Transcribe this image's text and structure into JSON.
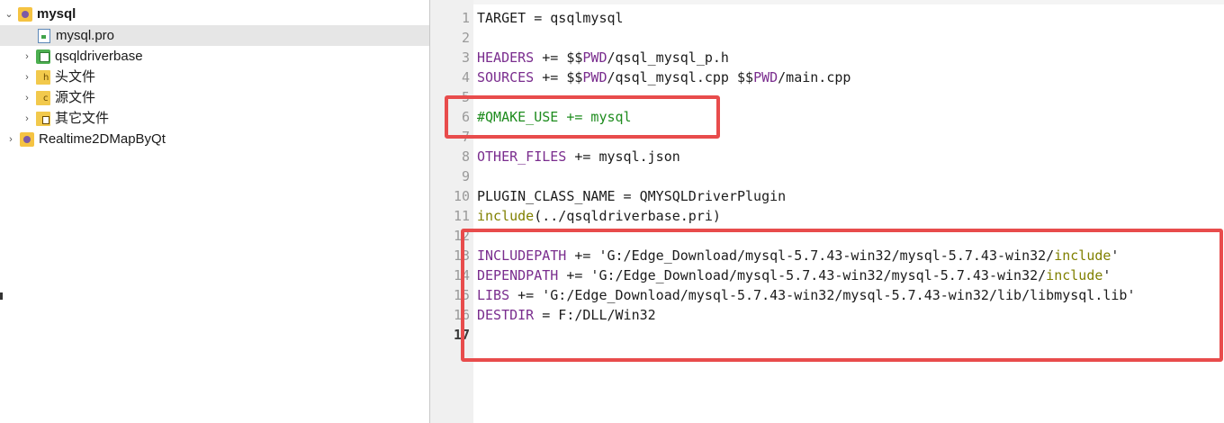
{
  "tree": {
    "items": [
      {
        "label": "mysql",
        "arrow": "⌄",
        "icon": "qt-project-icon",
        "bold": true
      },
      {
        "label": "mysql.pro",
        "arrow": "",
        "icon": "pro-file-icon",
        "selected": true
      },
      {
        "label": "qsqldriverbase",
        "arrow": "›",
        "icon": "pri-project-icon"
      },
      {
        "label": "头文件",
        "arrow": "›",
        "icon": "header-folder-icon"
      },
      {
        "label": "源文件",
        "arrow": "›",
        "icon": "source-folder-icon"
      },
      {
        "label": "其它文件",
        "arrow": "›",
        "icon": "other-files-folder-icon"
      },
      {
        "label": "Realtime2DMapByQt",
        "arrow": "›",
        "icon": "qt-project-icon"
      }
    ]
  },
  "editor": {
    "lines": [
      {
        "n": "1",
        "tokens": [
          [
            "plain",
            "TARGET = qsqlmysql"
          ]
        ]
      },
      {
        "n": "2",
        "tokens": []
      },
      {
        "n": "3",
        "tokens": [
          [
            "var",
            "HEADERS"
          ],
          [
            "plain",
            " += $$"
          ],
          [
            "var",
            "PWD"
          ],
          [
            "plain",
            "/qsql_mysql_p.h"
          ]
        ]
      },
      {
        "n": "4",
        "tokens": [
          [
            "var",
            "SOURCES"
          ],
          [
            "plain",
            " += $$"
          ],
          [
            "var",
            "PWD"
          ],
          [
            "plain",
            "/qsql_mysql.cpp $$"
          ],
          [
            "var",
            "PWD"
          ],
          [
            "plain",
            "/main.cpp"
          ]
        ]
      },
      {
        "n": "5",
        "tokens": []
      },
      {
        "n": "6",
        "tokens": [
          [
            "comment",
            "#QMAKE_USE += mysql"
          ]
        ]
      },
      {
        "n": "7",
        "tokens": []
      },
      {
        "n": "8",
        "tokens": [
          [
            "var",
            "OTHER_FILES"
          ],
          [
            "plain",
            " += mysql.json"
          ]
        ]
      },
      {
        "n": "9",
        "tokens": []
      },
      {
        "n": "10",
        "tokens": [
          [
            "plain",
            "PLUGIN_CLASS_NAME = QMYSQLDriverPlugin"
          ]
        ]
      },
      {
        "n": "11",
        "tokens": [
          [
            "kw",
            "include"
          ],
          [
            "plain",
            "(../qsqldriverbase.pri)"
          ]
        ]
      },
      {
        "n": "12",
        "tokens": []
      },
      {
        "n": "13",
        "tokens": [
          [
            "var",
            "INCLUDEPATH"
          ],
          [
            "plain",
            " += 'G:/Edge_Download/mysql-5.7.43-win32/mysql-5.7.43-win32/"
          ],
          [
            "kw",
            "include"
          ],
          [
            "plain",
            "'"
          ]
        ]
      },
      {
        "n": "14",
        "tokens": [
          [
            "var",
            "DEPENDPATH"
          ],
          [
            "plain",
            " += 'G:/Edge_Download/mysql-5.7.43-win32/mysql-5.7.43-win32/"
          ],
          [
            "kw",
            "include"
          ],
          [
            "plain",
            "'"
          ]
        ]
      },
      {
        "n": "15",
        "tokens": [
          [
            "var",
            "LIBS"
          ],
          [
            "plain",
            " += 'G:/Edge_Download/mysql-5.7.43-win32/mysql-5.7.43-win32/lib/libmysql.lib'"
          ]
        ]
      },
      {
        "n": "16",
        "tokens": [
          [
            "var",
            "DESTDIR"
          ],
          [
            "plain",
            " = F:/DLL/Win32"
          ]
        ]
      },
      {
        "n": "17",
        "tokens": [],
        "current": true
      }
    ]
  },
  "colors": {
    "annotation": "#e84c4c",
    "variable": "#7a2d8e",
    "keyword": "#808000",
    "comment": "#1e8c1e",
    "selection": "#e6e6e6"
  }
}
